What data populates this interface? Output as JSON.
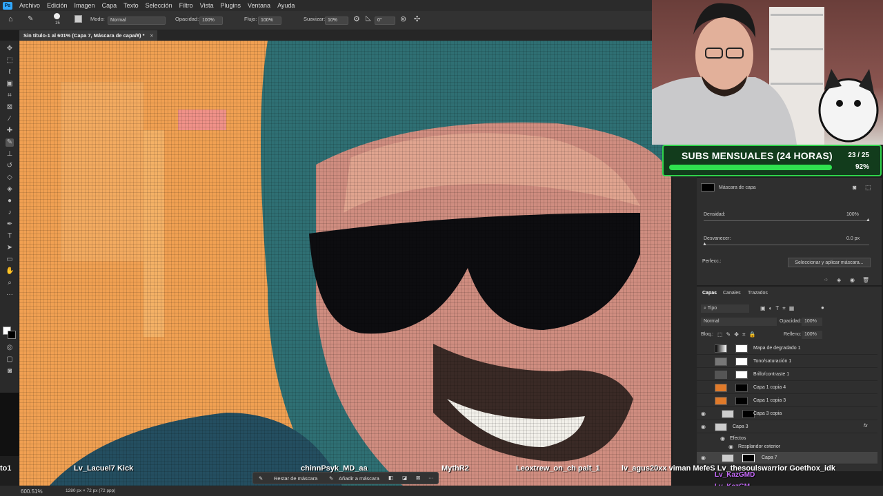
{
  "menu": [
    "Archivo",
    "Edición",
    "Imagen",
    "Capa",
    "Texto",
    "Selección",
    "Filtro",
    "Vista",
    "Plugins",
    "Ventana",
    "Ayuda"
  ],
  "options": {
    "brush_size": "15",
    "modo_label": "Modo:",
    "modo_value": "Normal",
    "opacidad_label": "Opacidad:",
    "opacidad_value": "100%",
    "flujo_label": "Flujo:",
    "flujo_value": "100%",
    "suavizar_label": "Suavizar:",
    "suavizar_value": "10%",
    "angle_value": "0°"
  },
  "document_tab": "Sin título-1 al 601% (Capa 7, Máscara de capa/8) *",
  "subs": {
    "title": "SUBS MENSUALES (24 HORAS)",
    "count": "23 / 25",
    "percent": "92%",
    "progress": 0.92
  },
  "properties": {
    "mask_label": "Máscara de capa",
    "densidad_label": "Densidad:",
    "densidad_value": "100%",
    "desvanecer_label": "Desvanecer:",
    "desvanecer_value": "0.0 px",
    "perfec_label": "Perfecc.:",
    "select_button": "Seleccionar y aplicar máscara..."
  },
  "layers_panel": {
    "tabs": [
      "Capas",
      "Canales",
      "Trazados"
    ],
    "filter": "Tipo",
    "blend": "Normal",
    "opacity_label": "Opacidad:",
    "opacity_value": "100%",
    "lock_label": "Bloq.:",
    "fill_label": "Relleno:",
    "fill_value": "100%",
    "layers": [
      {
        "name": "Mapa de degradado 1",
        "visible": false
      },
      {
        "name": "Tono/saturación 1",
        "visible": false
      },
      {
        "name": "Brillo/contraste 1",
        "visible": false
      },
      {
        "name": "Capa 1 copia 4",
        "visible": false
      },
      {
        "name": "Capa 1 copia 3",
        "visible": false
      },
      {
        "name": "Capa 3 copia",
        "visible": true
      },
      {
        "name": "Capa 3",
        "visible": true
      },
      {
        "name": "Efectos",
        "visible": true
      },
      {
        "name": "Resplandor exterior",
        "visible": true
      },
      {
        "name": "Capa 7",
        "visible": true
      }
    ]
  },
  "chat_names": [
    "to1",
    "Lv_Lacuel7 Kick",
    "chinnPsyk_MD_aa",
    "MythR2",
    "Leoxtrew_on_ch palt_1",
    "lv_agus20xx viman MefeS Lv_thesoulswarrior Goethox_idk"
  ],
  "chat_badges": [
    "Lv_KazGMD",
    "Lv_KazGM"
  ],
  "status_zoom": "600.51%",
  "status_size": "1280 px × 72 px (72 ppp)",
  "mask_bar": {
    "restar": "Restar de máscara",
    "anadir": "Añadir a máscara"
  }
}
